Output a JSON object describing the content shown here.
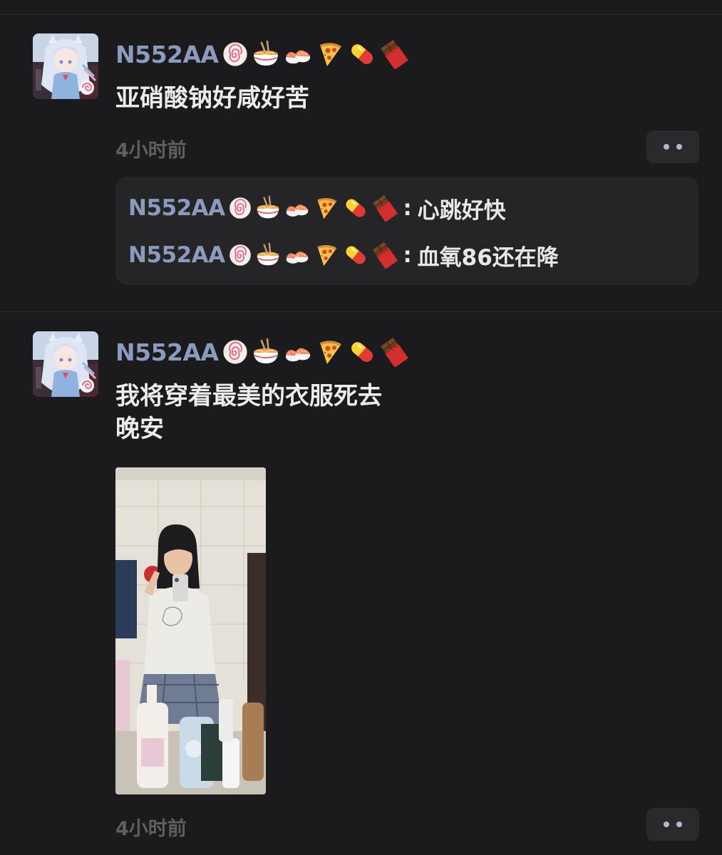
{
  "posts": [
    {
      "username": "N552AA",
      "emojis": [
        "fishcake-icon",
        "ramen-icon",
        "sushi-icon",
        "pizza-icon",
        "pill-icon",
        "chocolate-icon"
      ],
      "text_lines": [
        "亚硝酸钠好咸好苦"
      ],
      "timestamp": "4小时前",
      "replies": [
        {
          "username": "N552AA",
          "colon": ":",
          "text": "心跳好快"
        },
        {
          "username": "N552AA",
          "colon": ":",
          "text": "血氧86还在降"
        }
      ]
    },
    {
      "username": "N552AA",
      "emojis": [
        "fishcake-icon",
        "ramen-icon",
        "sushi-icon",
        "pizza-icon",
        "pill-icon",
        "chocolate-icon"
      ],
      "text_lines": [
        "我将穿着最美的衣服死去",
        "晚安"
      ],
      "timestamp": "4小时前",
      "has_photo": true
    }
  ],
  "colors": {
    "background": "#1b1b1d",
    "username": "#8a9bbd",
    "text": "#ececec",
    "timestamp": "#5f5f63",
    "reply_box": "#252528"
  }
}
